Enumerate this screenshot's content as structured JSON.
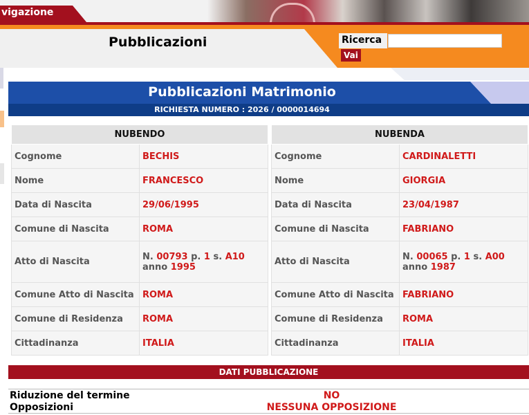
{
  "nav": {
    "tab_label": "vigazione"
  },
  "header": {
    "page_title": "Pubblicazioni",
    "search": {
      "label": "Ricerca",
      "value": "",
      "placeholder": "",
      "button_label": "Vai"
    }
  },
  "colors": {
    "brand_red": "#a3101e",
    "brand_orange": "#f58a1f",
    "title_blue": "#1d4fa8",
    "value_red": "#d01a1a"
  },
  "main": {
    "title": "Pubblicazioni Matrimonio",
    "request_number": "RICHIESTA NUMERO : 2026 / 0000014694"
  },
  "nubendo": {
    "heading": "NUBENDO",
    "cognome_label": "Cognome",
    "cognome": "BECHIS",
    "nome_label": "Nome",
    "nome": "FRANCESCO",
    "data_nascita_label": "Data di Nascita",
    "data_nascita": "29/06/1995",
    "comune_nascita_label": "Comune di Nascita",
    "comune_nascita": "ROMA",
    "atto_label": "Atto di Nascita",
    "atto": {
      "prefix": "N.",
      "numero": "00793",
      "p_label": "p.",
      "parte": "1",
      "s_label": "s.",
      "serie": "A10",
      "anno_label": "anno",
      "anno": "1995"
    },
    "comune_atto_label": "Comune Atto di Nascita",
    "comune_atto": "ROMA",
    "comune_residenza_label": "Comune di Residenza",
    "comune_residenza": "ROMA",
    "cittadinanza_label": "Cittadinanza",
    "cittadinanza": "ITALIA"
  },
  "nubenda": {
    "heading": "NUBENDA",
    "cognome_label": "Cognome",
    "cognome": "CARDINALETTI",
    "nome_label": "Nome",
    "nome": "GIORGIA",
    "data_nascita_label": "Data di Nascita",
    "data_nascita": "23/04/1987",
    "comune_nascita_label": "Comune di Nascita",
    "comune_nascita": "FABRIANO",
    "atto_label": "Atto di Nascita",
    "atto": {
      "prefix": "N.",
      "numero": "00065",
      "p_label": "p.",
      "parte": "1",
      "s_label": "s.",
      "serie": "A00",
      "anno_label": "anno",
      "anno": "1987"
    },
    "comune_atto_label": "Comune Atto di Nascita",
    "comune_atto": "FABRIANO",
    "comune_residenza_label": "Comune di Residenza",
    "comune_residenza": "ROMA",
    "cittadinanza_label": "Cittadinanza",
    "cittadinanza": "ITALIA"
  },
  "dati_pubblicazione": {
    "heading": "DATI PUBBLICAZIONE",
    "riduzione_label": "Riduzione del termine",
    "riduzione_value": "NO",
    "opposizioni_label": "Opposizioni",
    "opposizioni_value": "NESSUNA OPPOSIZIONE"
  }
}
